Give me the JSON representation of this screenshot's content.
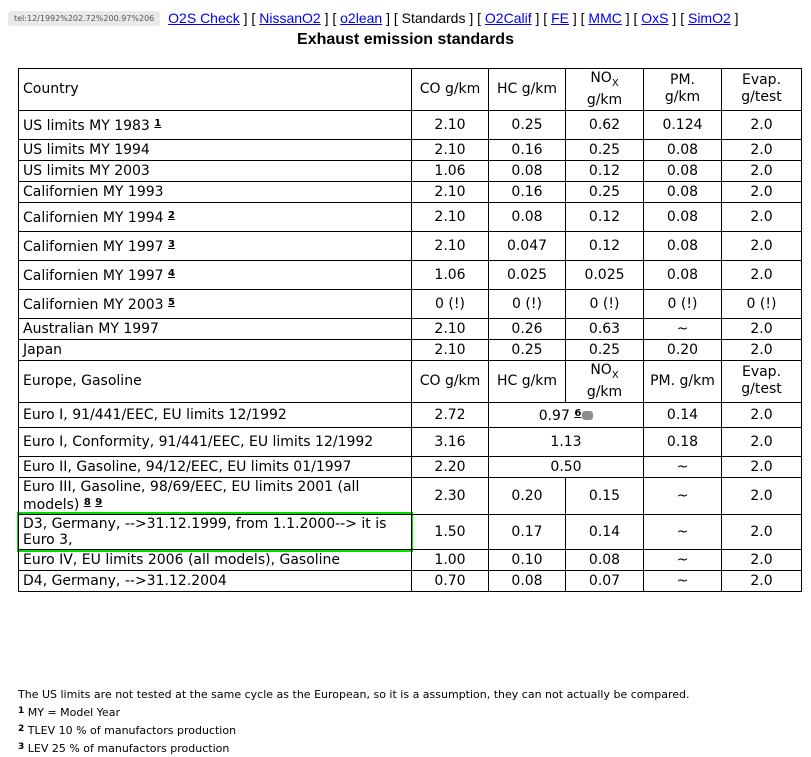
{
  "nav": {
    "tel_badge": "tel:12/1992%202.72%200.97%206",
    "links": [
      "O2S Check",
      "NissanO2",
      "o2lean",
      "Standards",
      "O2Calif",
      "FE",
      "MMC",
      "OxS",
      "SimO2"
    ]
  },
  "title": "Exhaust emission standards",
  "header_us": {
    "country": "Country",
    "co": "CO g/km",
    "hc": "HC g/km",
    "nox_base": "NO",
    "nox_sub": "X",
    "nox_unit": "g/km",
    "pm": "PM.",
    "pm_unit": "g/km",
    "evap": "Evap.",
    "evap_unit": "g/test"
  },
  "rows_us": [
    {
      "label": "US limits MY 1983",
      "fn": "1",
      "co": "2.10",
      "hc": "0.25",
      "nox": "0.62",
      "pm": "0.124",
      "evap": "2.0"
    },
    {
      "label": "US limits MY 1994",
      "fn": "",
      "co": "2.10",
      "hc": "0.16",
      "nox": "0.25",
      "pm": "0.08",
      "evap": "2.0"
    },
    {
      "label": "US limits MY 2003",
      "fn": "",
      "co": "1.06",
      "hc": "0.08",
      "nox": "0.12",
      "pm": "0.08",
      "evap": "2.0"
    },
    {
      "label": "Californien MY 1993",
      "fn": "",
      "co": "2.10",
      "hc": "0.16",
      "nox": "0.25",
      "pm": "0.08",
      "evap": "2.0"
    },
    {
      "label": "Californien MY 1994",
      "fn": "2",
      "co": "2.10",
      "hc": "0.08",
      "nox": "0.12",
      "pm": "0.08",
      "evap": "2.0"
    },
    {
      "label": "Californien MY 1997",
      "fn": "3",
      "co": "2.10",
      "hc": "0.047",
      "nox": "0.12",
      "pm": "0.08",
      "evap": "2.0"
    },
    {
      "label": "Californien MY 1997",
      "fn": "4",
      "co": "1.06",
      "hc": "0.025",
      "nox": "0.025",
      "pm": "0.08",
      "evap": "2.0"
    },
    {
      "label": "Californien MY 2003",
      "fn": "5",
      "co": "0 (!)",
      "hc": "0 (!)",
      "nox": "0 (!)",
      "pm": "0 (!)",
      "evap": "0 (!)"
    },
    {
      "label": "Australian MY 1997",
      "fn": "",
      "co": "2.10",
      "hc": "0.26",
      "nox": "0.63",
      "pm": "~",
      "evap": "2.0"
    },
    {
      "label": "Japan",
      "fn": "",
      "co": "2.10",
      "hc": "0.25",
      "nox": "0.25",
      "pm": "0.20",
      "evap": "2.0"
    }
  ],
  "header_eu": {
    "country": "Europe, Gasoline",
    "co": "CO g/km",
    "hc": "HC g/km",
    "nox_base": "NO",
    "nox_sub": "X",
    "nox_unit": "g/km",
    "pm": "PM. g/km",
    "evap": "Evap.",
    "evap_unit": "g/test"
  },
  "rows_eu": {
    "euro1": {
      "label": "Euro I, 91/441/EEC, EU limits 12/1992",
      "co": "2.72",
      "hcnox": "0.97",
      "fn": "6",
      "pm": "0.14",
      "evap": "2.0"
    },
    "euro1c": {
      "label": "Euro I, Conformity, 91/441/EEC, EU limits 12/1992",
      "co": "3.16",
      "hcnox": "1.13",
      "pm": "0.18",
      "evap": "2.0"
    },
    "euro2": {
      "label": "Euro II, Gasoline, 94/12/EEC, EU limits 01/1997",
      "co": "2.20",
      "hcnox": "0.50",
      "pm": "~",
      "evap": "2.0"
    },
    "euro3": {
      "label": "Euro III, Gasoline, 98/69/EEC, EU limits 2001 (all models)",
      "fn_a": "8",
      "fn_b": "9",
      "co": "2.30",
      "hc": "0.20",
      "nox": "0.15",
      "pm": "~",
      "evap": "2.0"
    },
    "d3": {
      "label": "D3, Germany, -->31.12.1999, from 1.1.2000--> it is Euro 3,",
      "co": "1.50",
      "hc": "0.17",
      "nox": "0.14",
      "pm": "~",
      "evap": "2.0"
    },
    "euro4": {
      "label": "Euro IV, EU limits 2006 (all models), Gasoline",
      "co": "1.00",
      "hc": "0.10",
      "nox": "0.08",
      "pm": "~",
      "evap": "2.0"
    },
    "d4": {
      "label": "D4, Germany, -->31.12.2004",
      "co": "0.70",
      "hc": "0.08",
      "nox": "0.07",
      "pm": "~",
      "evap": "2.0"
    }
  },
  "footer": {
    "note": "The US limits are not tested at the same cycle as the European, so it is a assumption, they can not actually be compared.",
    "footnotes": [
      {
        "num": "1",
        "text": "MY = Model Year"
      },
      {
        "num": "2",
        "text": "TLEV 10 % of manufactors production"
      },
      {
        "num": "3",
        "text": "LEV 25 % of manufactors production"
      }
    ]
  },
  "colors": {
    "link": "#0000ee",
    "highlight": "#00e000"
  }
}
